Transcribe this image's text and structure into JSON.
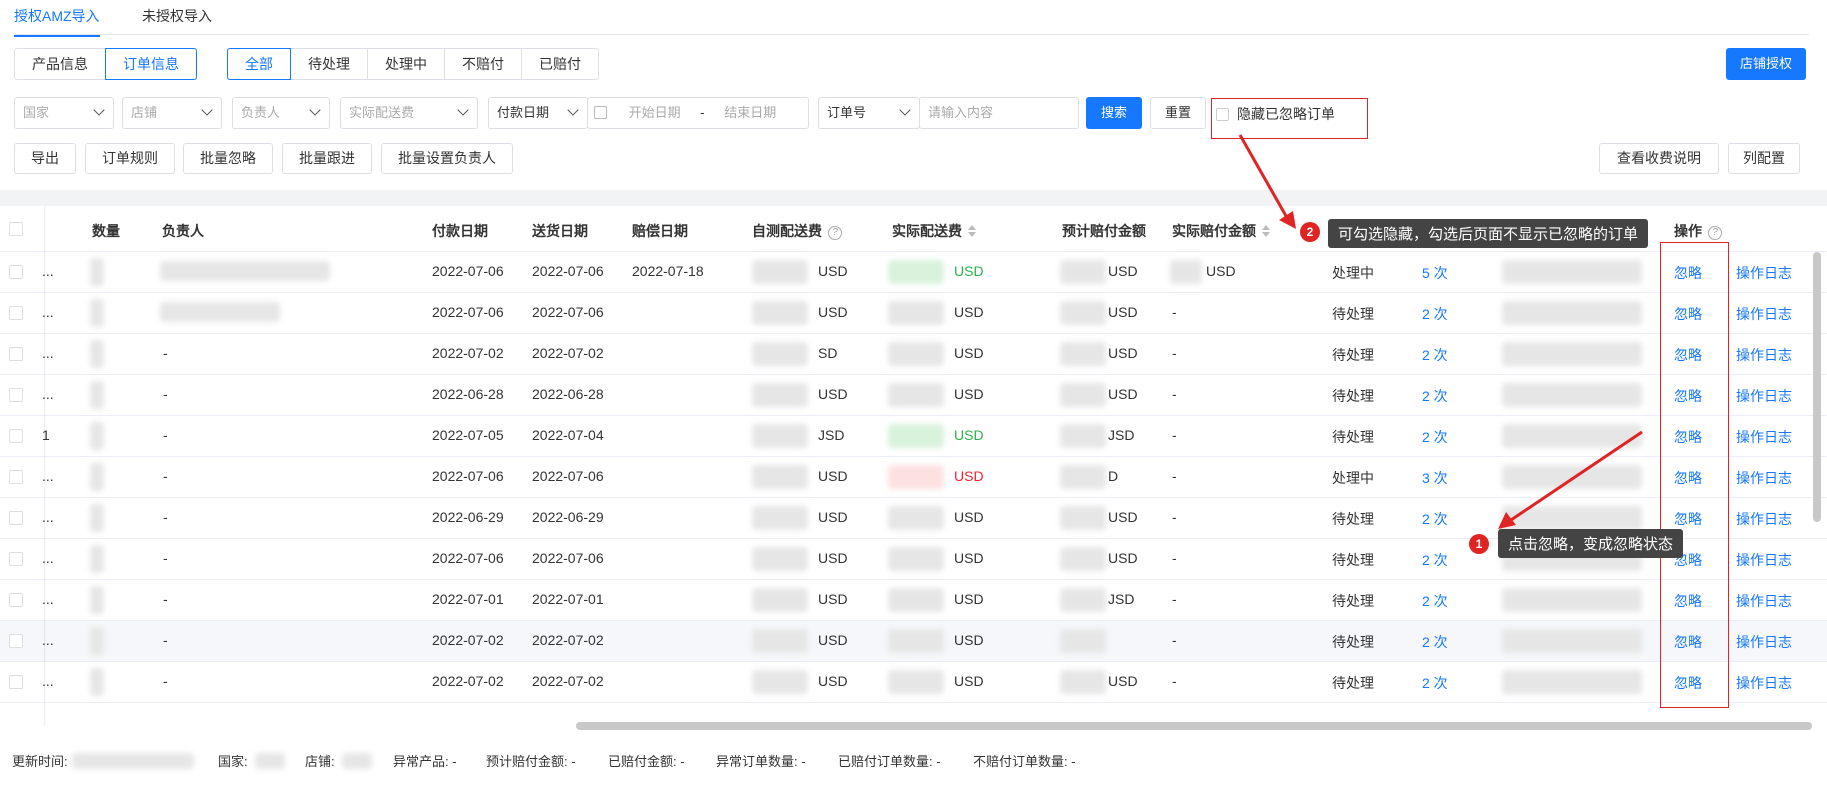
{
  "tabs": [
    "授权AMZ导入",
    "未授权导入"
  ],
  "view_toggle": [
    "产品信息",
    "订单信息"
  ],
  "status_filter": [
    "全部",
    "待处理",
    "处理中",
    "不赔付",
    "已赔付"
  ],
  "shop_auth_button": "店铺授权",
  "filters": {
    "country": "国家",
    "shop": "店铺",
    "owner": "负责人",
    "actual_shipping": "实际配送费",
    "pay_date": "付款日期",
    "start_date": "开始日期",
    "date_sep": "-",
    "end_date": "结束日期",
    "order_no": "订单号",
    "search_placeholder": "请输入内容",
    "search_btn": "搜索",
    "reset_btn": "重置",
    "hide_ignored": "隐藏已忽略订单"
  },
  "actions": [
    "导出",
    "订单规则",
    "批量忽略",
    "批量跟进",
    "批量设置负责人"
  ],
  "right_actions": [
    "查看收费说明",
    "列配置"
  ],
  "columns": {
    "qty": "数量",
    "owner": "负责人",
    "pay_date": "付款日期",
    "ship_date": "送货日期",
    "comp_date": "赔偿日期",
    "est_fee": "自测配送费",
    "actual_fee": "实际配送费",
    "est_comp": "预计赔付金额",
    "actual_comp": "实际赔付金额",
    "ops": "操作"
  },
  "rows": [
    {
      "lead": "...",
      "owner": "",
      "pay": "2022-07-06",
      "ship": "2022-07-06",
      "comp": "2022-07-18",
      "est": "USD",
      "act": "USD",
      "act_color": "green",
      "estc": "USD",
      "actc": "USD",
      "status": "处理中",
      "count": "5 次",
      "ignore": "忽略",
      "log": "操作日志"
    },
    {
      "lead": "...",
      "owner": "",
      "pay": "2022-07-06",
      "ship": "2022-07-06",
      "comp": "",
      "est": "USD",
      "act": "USD",
      "act_color": "",
      "estc": "USD",
      "actc": "-",
      "status": "待处理",
      "count": "2 次",
      "ignore": "忽略",
      "log": "操作日志"
    },
    {
      "lead": "...",
      "owner": "-",
      "pay": "2022-07-02",
      "ship": "2022-07-02",
      "comp": "",
      "est": "SD",
      "act": "USD",
      "act_color": "",
      "estc": "USD",
      "actc": "-",
      "status": "待处理",
      "count": "2 次",
      "ignore": "忽略",
      "log": "操作日志"
    },
    {
      "lead": "...",
      "owner": "-",
      "pay": "2022-06-28",
      "ship": "2022-06-28",
      "comp": "",
      "est": "USD",
      "act": "USD",
      "act_color": "",
      "estc": "USD",
      "actc": "-",
      "status": "待处理",
      "count": "2 次",
      "ignore": "忽略",
      "log": "操作日志"
    },
    {
      "lead": "1",
      "owner": "-",
      "pay": "2022-07-05",
      "ship": "2022-07-04",
      "comp": "",
      "est": "JSD",
      "act": "USD",
      "act_color": "green",
      "estc": "JSD",
      "actc": "-",
      "status": "待处理",
      "count": "2 次",
      "ignore": "忽略",
      "log": "操作日志"
    },
    {
      "lead": "...",
      "owner": "-",
      "pay": "2022-07-06",
      "ship": "2022-07-06",
      "comp": "",
      "est": "USD",
      "act": "USD",
      "act_color": "red",
      "estc": "D",
      "actc": "-",
      "status": "处理中",
      "count": "3 次",
      "ignore": "忽略",
      "log": "操作日志"
    },
    {
      "lead": "...",
      "owner": "-",
      "pay": "2022-06-29",
      "ship": "2022-06-29",
      "comp": "",
      "est": "USD",
      "act": "USD",
      "act_color": "",
      "estc": "USD",
      "actc": "-",
      "status": "待处理",
      "count": "2 次",
      "ignore": "忽略",
      "log": "操作日志"
    },
    {
      "lead": "...",
      "owner": "-",
      "pay": "2022-07-06",
      "ship": "2022-07-06",
      "comp": "",
      "est": "USD",
      "act": "USD",
      "act_color": "",
      "estc": "USD",
      "actc": "-",
      "status": "待处理",
      "count": "2 次",
      "ignore": "忽略",
      "log": "操作日志"
    },
    {
      "lead": "...",
      "owner": "-",
      "pay": "2022-07-01",
      "ship": "2022-07-01",
      "comp": "",
      "est": "USD",
      "act": "USD",
      "act_color": "",
      "estc": "JSD",
      "actc": "-",
      "status": "待处理",
      "count": "2 次",
      "ignore": "忽略",
      "log": "操作日志"
    },
    {
      "lead": "...",
      "owner": "-",
      "pay": "2022-07-02",
      "ship": "2022-07-02",
      "comp": "",
      "est": "USD",
      "act": "USD",
      "act_color": "",
      "estc": "",
      "actc": "-",
      "status": "待处理",
      "count": "2 次",
      "ignore": "忽略",
      "log": "操作日志"
    },
    {
      "lead": "...",
      "owner": "-",
      "pay": "2022-07-02",
      "ship": "2022-07-02",
      "comp": "",
      "est": "USD",
      "act": "USD",
      "act_color": "",
      "estc": "USD",
      "actc": "-",
      "status": "待处理",
      "count": "2 次",
      "ignore": "忽略",
      "log": "操作日志"
    }
  ],
  "footer": {
    "updated": "更新时间:",
    "country": "国家:",
    "shop": "店铺:",
    "abnormal_products": "异常产品: -",
    "est_comp": "预计赔付金额: -",
    "paid_amount": "已赔付金额: -",
    "abnormal_orders": "异常订单数量: -",
    "paid_orders": "已赔付订单数量: -",
    "unpaid_orders": "不赔付订单数量: -"
  },
  "annotations": {
    "badge1": "1",
    "tip1": "点击忽略，变成忽略状态",
    "badge2": "2",
    "tip2": "可勾选隐藏，勾选后页面不显示已忽略的订单"
  },
  "colors": {
    "primary": "#1677ff",
    "annotation": "#e02424",
    "green": "#2bb24c",
    "red": "#f5222d"
  }
}
